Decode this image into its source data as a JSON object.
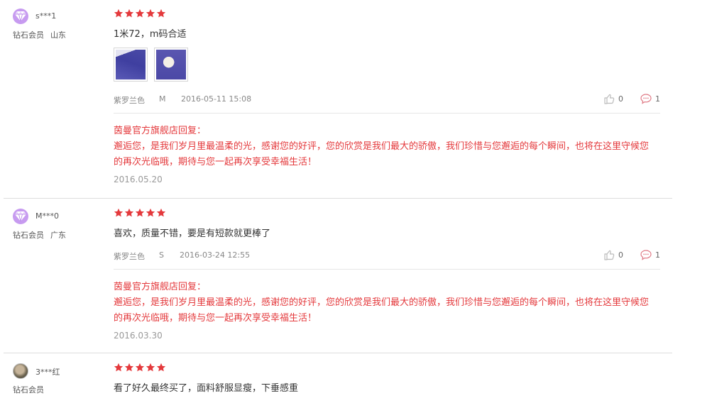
{
  "colors": {
    "star": "#e4393c",
    "reply_text": "#e4393c",
    "diamond_badge": "#c79bf0",
    "meta_text": "#888888",
    "divider": "#dddddd"
  },
  "reviews": [
    {
      "username": "s***1",
      "level": "钻石会员",
      "location": "山东",
      "avatar_icon": "diamond-icon",
      "rating": 5,
      "comment": "1米72，m码合适",
      "photos": [
        "review-photo-1",
        "review-photo-2"
      ],
      "color_name": "紫罗兰色",
      "size": "M",
      "date": "2016-05-11 15:08",
      "likes": "0",
      "replies": "1",
      "shop_reply": {
        "title": "茵曼官方旗舰店回复：",
        "text": "邂逅您，是我们岁月里最温柔的光，感谢您的好评，您的欣赏是我们最大的骄傲，我们珍惜与您邂逅的每个瞬间，也将在这里守候您的再次光临哦，期待与您一起再次享受幸福生活！",
        "date": "2016.05.20"
      }
    },
    {
      "username": "M***0",
      "level": "钻石会员",
      "location": "广东",
      "avatar_icon": "diamond-icon",
      "rating": 5,
      "comment": "喜欢，质量不错，要是有短款就更棒了",
      "color_name": "紫罗兰色",
      "size": "S",
      "date": "2016-03-24 12:55",
      "likes": "0",
      "replies": "1",
      "shop_reply": {
        "title": "茵曼官方旗舰店回复：",
        "text": "邂逅您，是我们岁月里最温柔的光，感谢您的好评，您的欣赏是我们最大的骄傲，我们珍惜与您邂逅的每个瞬间，也将在这里守候您的再次光临哦，期待与您一起再次享受幸福生活！",
        "date": "2016.03.30"
      }
    },
    {
      "username": "3***红",
      "level": "钻石会员",
      "location": "",
      "avatar_icon": "user-photo-avatar",
      "rating": 5,
      "comment": "看了好久最终买了，面料舒服显瘦，下垂感重"
    }
  ]
}
